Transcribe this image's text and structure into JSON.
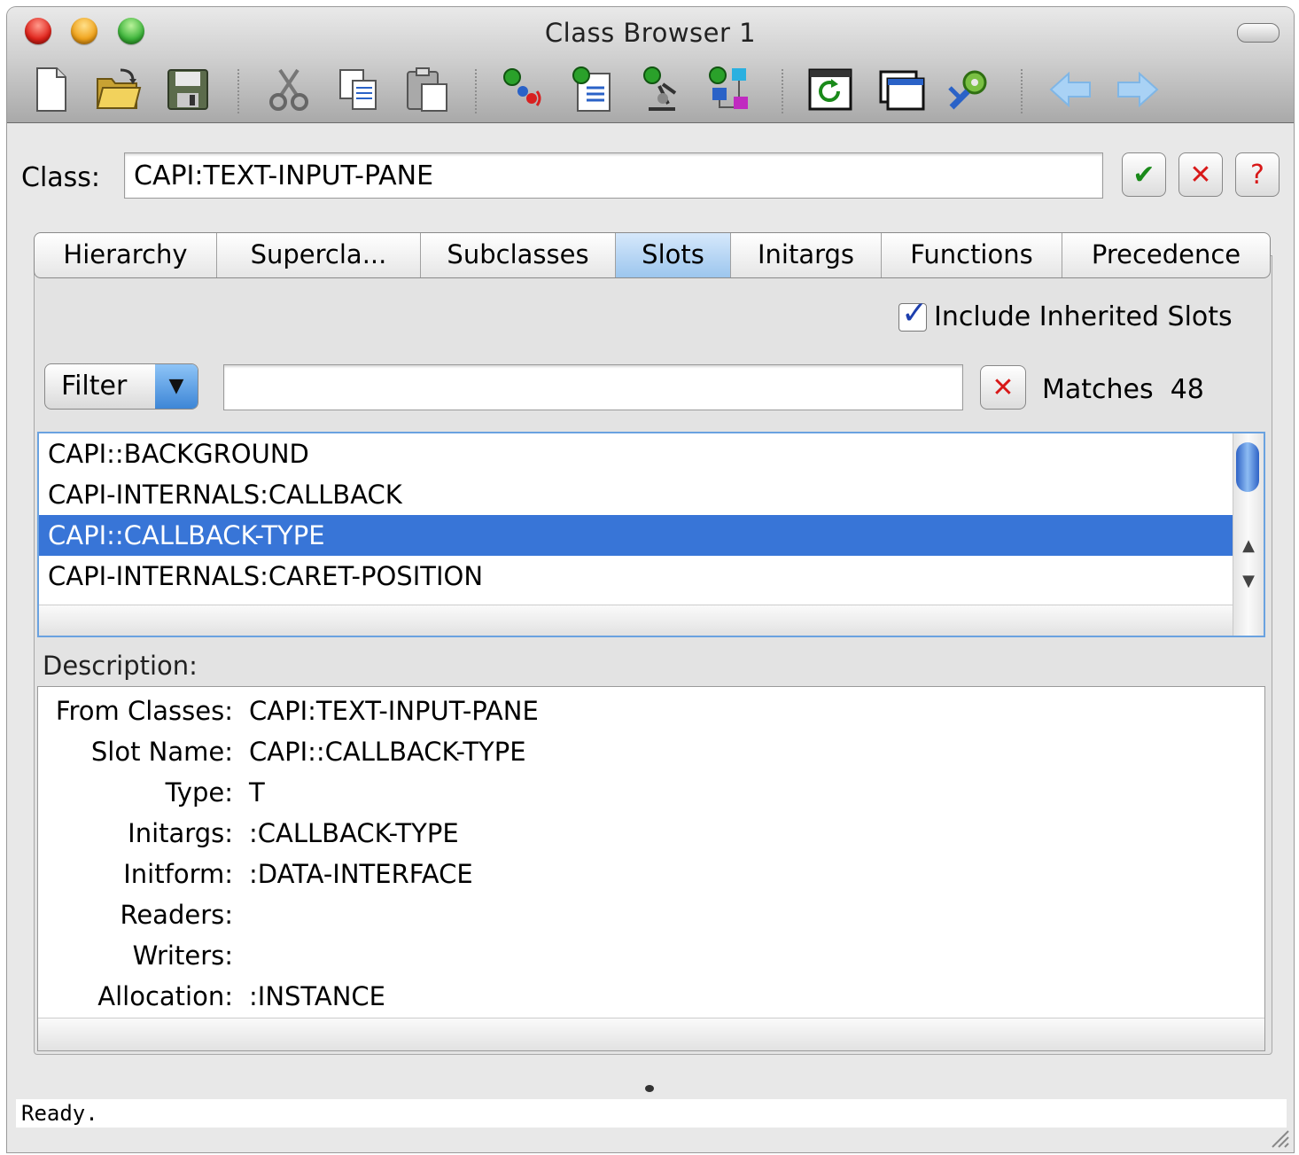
{
  "window": {
    "title": "Class Browser 1"
  },
  "toolbar": {
    "items": [
      {
        "icon": "new-file-icon"
      },
      {
        "icon": "open-folder-icon"
      },
      {
        "icon": "save-icon"
      },
      {
        "icon": "cut-icon"
      },
      {
        "icon": "copy-icon"
      },
      {
        "icon": "paste-icon"
      },
      {
        "icon": "inspect-icon"
      },
      {
        "icon": "list-icon"
      },
      {
        "icon": "browser-icon"
      },
      {
        "icon": "graph-icon"
      },
      {
        "icon": "refresh-icon"
      },
      {
        "icon": "window-icon"
      },
      {
        "icon": "tools-icon"
      },
      {
        "icon": "back-arrow-icon"
      },
      {
        "icon": "forward-arrow-icon"
      }
    ]
  },
  "class_row": {
    "label": "Class:",
    "value": "CAPI:TEXT-INPUT-PANE",
    "ok_glyph": "✔",
    "cancel_glyph": "✕",
    "help_glyph": "?"
  },
  "tabs": [
    {
      "label": "Hierarchy"
    },
    {
      "label": "Supercla..."
    },
    {
      "label": "Subclasses"
    },
    {
      "label": "Slots",
      "active": true
    },
    {
      "label": "Initargs"
    },
    {
      "label": "Functions"
    },
    {
      "label": "Precedence"
    }
  ],
  "slots_panel": {
    "include_inherited_label": "Include Inherited Slots",
    "include_inherited_checked": true,
    "filter_label": "Filter",
    "filter_value": "",
    "matches_label": "Matches",
    "matches_count": "48",
    "list": [
      "CAPI::BACKGROUND",
      "CAPI-INTERNALS:CALLBACK",
      "CAPI::CALLBACK-TYPE",
      "CAPI-INTERNALS:CARET-POSITION"
    ],
    "selected_index": 2
  },
  "description": {
    "label": "Description:",
    "rows": [
      {
        "key": "From Classes:",
        "value": "CAPI:TEXT-INPUT-PANE"
      },
      {
        "key": "Slot Name:",
        "value": "CAPI::CALLBACK-TYPE"
      },
      {
        "key": "Type:",
        "value": "T"
      },
      {
        "key": "Initargs:",
        "value": ":CALLBACK-TYPE"
      },
      {
        "key": "Initform:",
        "value": ":DATA-INTERFACE"
      },
      {
        "key": "Readers:",
        "value": ""
      },
      {
        "key": "Writers:",
        "value": ""
      },
      {
        "key": "Allocation:",
        "value": ":INSTANCE"
      }
    ]
  },
  "status": {
    "text": "Ready."
  }
}
